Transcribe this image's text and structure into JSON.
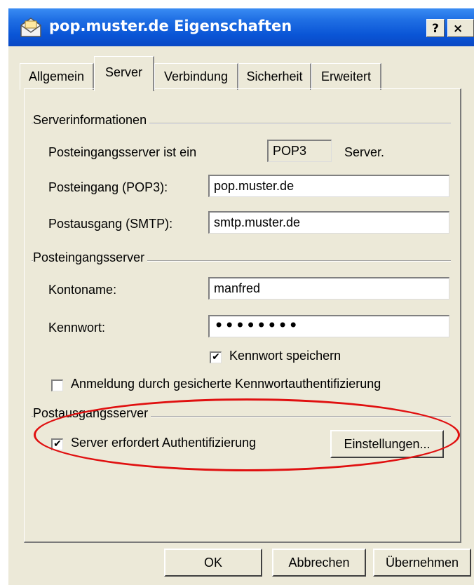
{
  "window": {
    "title": "pop.muster.de Eigenschaften",
    "help_label": "?",
    "close_label": "×"
  },
  "tabs": [
    {
      "label": "Allgemein",
      "active": false
    },
    {
      "label": "Server",
      "active": true
    },
    {
      "label": "Verbindung",
      "active": false
    },
    {
      "label": "Sicherheit",
      "active": false
    },
    {
      "label": "Erweitert",
      "active": false
    }
  ],
  "server_info": {
    "group_title": "Serverinformationen",
    "incoming_type_label": "Posteingangsserver ist ein",
    "incoming_type_value": "POP3",
    "incoming_type_suffix": "Server.",
    "pop3_label": "Posteingang (POP3):",
    "pop3_value": "pop.muster.de",
    "smtp_label": "Postausgang (SMTP):",
    "smtp_value": "smtp.muster.de"
  },
  "incoming_server": {
    "group_title": "Posteingangsserver",
    "account_label": "Kontoname:",
    "account_value": "manfred",
    "password_label": "Kennwort:",
    "password_value": "••••••••",
    "save_password_label": "Kennwort speichern",
    "save_password_checked": true,
    "spa_label": "Anmeldung durch gesicherte Kennwortauthentifizierung",
    "spa_checked": false
  },
  "outgoing_server": {
    "group_title": "Postausgangsserver",
    "auth_label": "Server erfordert Authentifizierung",
    "auth_checked": true,
    "settings_button": "Einstellungen..."
  },
  "footer": {
    "ok": "OK",
    "cancel": "Abbrechen",
    "apply": "Übernehmen"
  },
  "colors": {
    "titlebar": "#0a55d6",
    "dialog_bg": "#ece9d8",
    "annotation_oval": "#e01010"
  },
  "icons": {
    "title": "envelope-mail-icon",
    "check": "check-mark"
  }
}
